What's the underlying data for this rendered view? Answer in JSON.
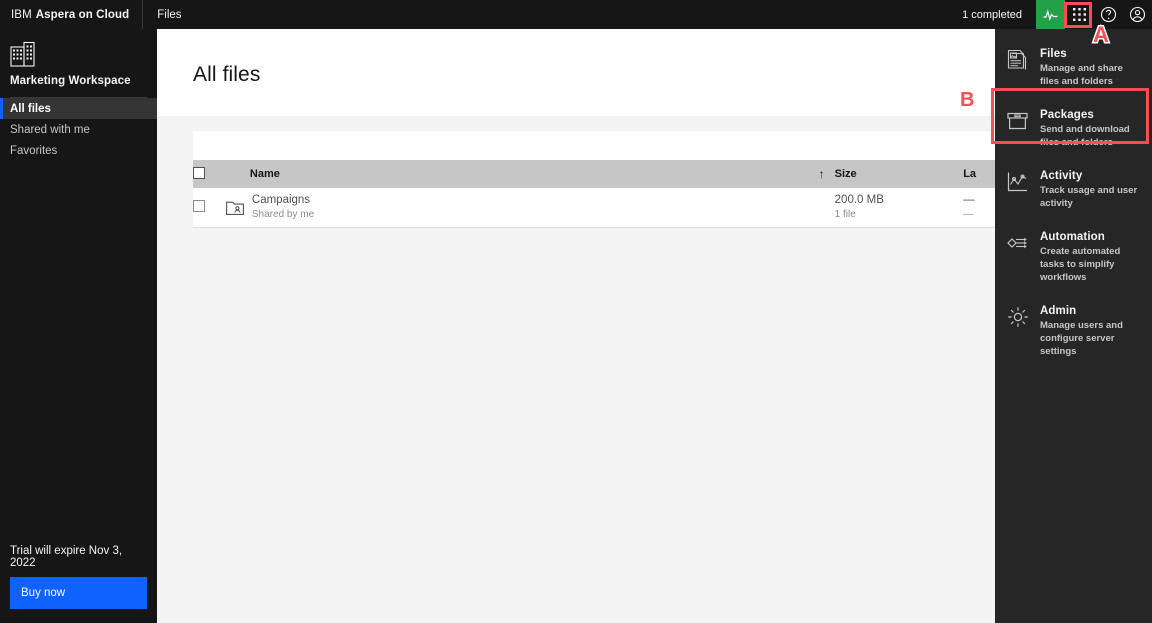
{
  "topbar": {
    "brand_prefix": "IBM",
    "brand_name": "Aspera on Cloud",
    "app_label": "Files",
    "status_text": "1 completed",
    "icons": {
      "activity": "activity-pulse-icon",
      "apps": "apps-grid-icon",
      "help": "help-circle-icon",
      "account": "user-avatar-icon"
    }
  },
  "sidebar": {
    "workspace_icon": "building-workspace-icon",
    "workspace_title": "Marketing Workspace",
    "items": [
      {
        "label": "All files",
        "active": true
      },
      {
        "label": "Shared with me",
        "active": false
      },
      {
        "label": "Favorites",
        "active": false
      }
    ],
    "trial_text": "Trial will expire Nov 3, 2022",
    "buy_label": "Buy now"
  },
  "main": {
    "page_title": "All files",
    "table": {
      "columns": [
        "Name",
        "Size",
        "La"
      ],
      "sort_icon": "sort-ascending-arrow-icon",
      "rows": [
        {
          "icon": "shared-folder-icon",
          "name": "Campaigns",
          "name_sub": "Shared by me",
          "size": "200.0 MB",
          "size_sub": "1 file",
          "modified": "—",
          "modified_sub": "—"
        }
      ]
    }
  },
  "switcher": {
    "items": [
      {
        "icon": "files-document-icon",
        "title": "Files",
        "desc": "Manage and share files and folders",
        "selected": false
      },
      {
        "icon": "packages-box-icon",
        "title": "Packages",
        "desc": "Send and download files and folders",
        "selected": true
      },
      {
        "icon": "activity-chart-icon",
        "title": "Activity",
        "desc": "Track usage and user activity",
        "selected": false
      },
      {
        "icon": "automation-flow-icon",
        "title": "Automation",
        "desc": "Create automated tasks to simplify workflows",
        "selected": false
      },
      {
        "icon": "admin-gear-icon",
        "title": "Admin",
        "desc": "Manage users and configure server settings",
        "selected": false
      }
    ]
  },
  "annotations": {
    "marker_a": "A",
    "marker_b": "B"
  },
  "colors": {
    "accent_blue": "#0f62fe",
    "highlight_red": "#fa4d56",
    "activity_green": "#24a148",
    "dark_bg": "#161616",
    "panel_bg": "#262626"
  }
}
